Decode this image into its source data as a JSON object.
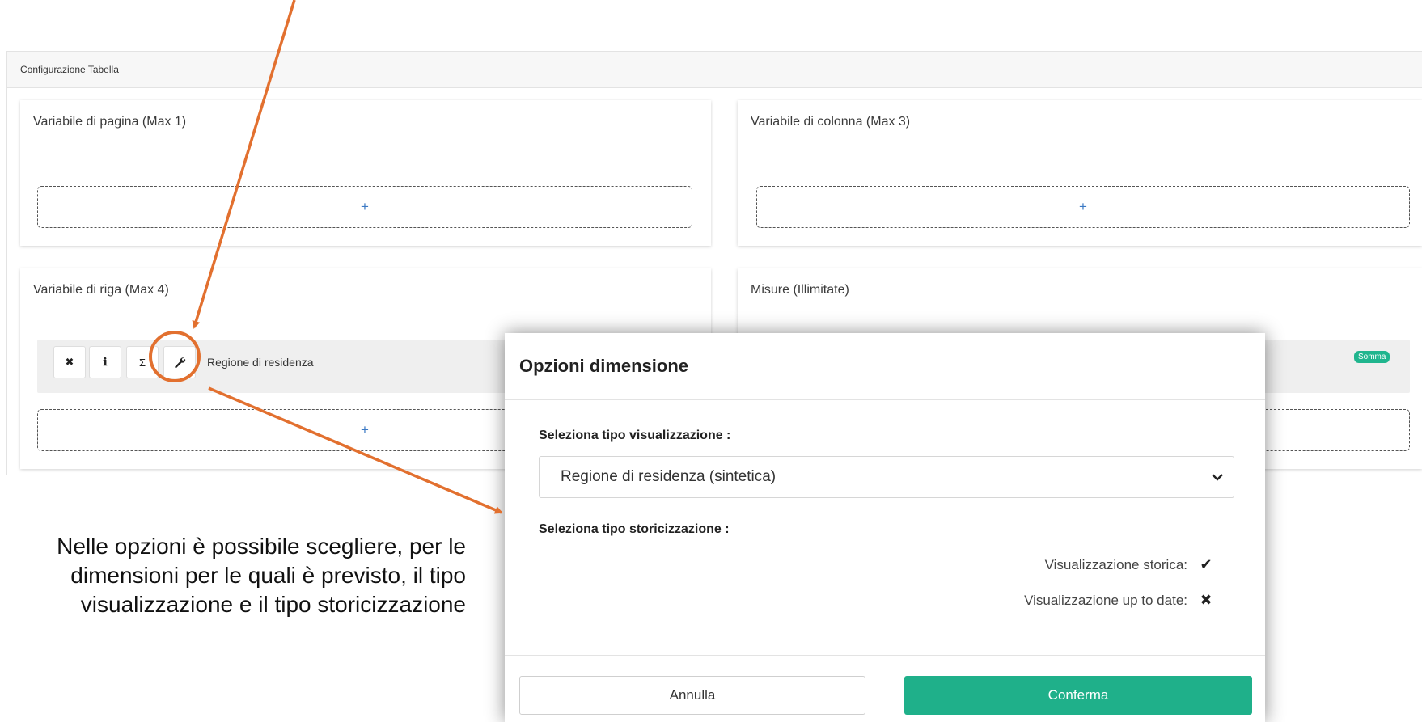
{
  "config": {
    "header": "Configurazione Tabella",
    "cards": {
      "page_var": {
        "title": "Variabile di pagina (Max 1)",
        "add": "+"
      },
      "col_var": {
        "title": "Variabile di colonna (Max 3)",
        "add": "+"
      },
      "row_var": {
        "title": "Variabile di riga (Max 4)",
        "add": "+",
        "item": {
          "name": "Regione di residenza",
          "tools": {
            "remove": "✖",
            "info": "ℹ",
            "sum": "Σ",
            "wrench": "🔧"
          }
        }
      },
      "measures": {
        "title": "Misure (Illimitate)",
        "add": "+",
        "badge": "Somma"
      }
    }
  },
  "modal": {
    "title": "Opzioni dimensione",
    "view_type_label": "Seleziona tipo visualizzazione :",
    "view_type_value": "Regione di residenza (sintetica)",
    "history_label": "Seleziona tipo storicizzazione :",
    "options": [
      {
        "label": "Visualizzazione storica:",
        "mark": "✔"
      },
      {
        "label": "Visualizzazione up to date:",
        "mark": "✖"
      }
    ],
    "cancel": "Annulla",
    "confirm": "Conferma"
  },
  "annotation": "Nelle opzioni è possibile scegliere, per le dimensioni per le quali è previsto, il tipo visualizzazione e il tipo storicizzazione",
  "colors": {
    "accent": "#1fb08a",
    "arrow": "#e2702f",
    "plus": "#3b79c4"
  }
}
